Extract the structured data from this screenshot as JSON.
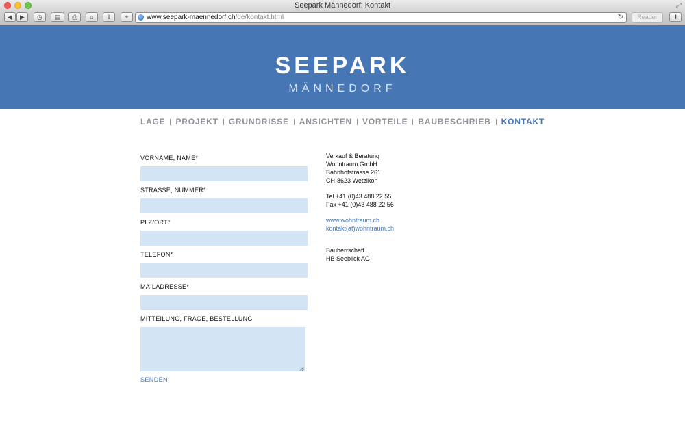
{
  "window": {
    "title": "Seepark Männedorf: Kontakt"
  },
  "toolbar": {
    "back_icon": "◀",
    "forward_icon": "▶",
    "history_icon": "◷",
    "bookmarks_icon": "▤",
    "print_icon": "⎙",
    "home_icon": "⌂",
    "share_icon": "⇪",
    "add_icon": "+",
    "url_domain": "www.seepark-maennedorf.ch",
    "url_path": "/de/kontakt.html",
    "reload_icon": "↻",
    "reader_label": "Reader",
    "downloads_icon": "⬇"
  },
  "header": {
    "logo_main": "SEEPARK",
    "logo_sub": "MÄNNEDORF",
    "bg_color": "#4676b3"
  },
  "nav": {
    "items": [
      {
        "label": "LAGE",
        "active": false
      },
      {
        "label": "PROJEKT",
        "active": false
      },
      {
        "label": "GRUNDRISSE",
        "active": false
      },
      {
        "label": "ANSICHTEN",
        "active": false
      },
      {
        "label": "VORTEILE",
        "active": false
      },
      {
        "label": "BAUBESCHRIEB",
        "active": false
      },
      {
        "label": "KONTAKT",
        "active": true
      }
    ]
  },
  "form": {
    "fields": [
      {
        "label": "VORNAME, NAME*",
        "value": ""
      },
      {
        "label": "STRASSE, NUMMER*",
        "value": ""
      },
      {
        "label": "PLZ/ORT*",
        "value": ""
      },
      {
        "label": "TELEFON*",
        "value": ""
      },
      {
        "label": "MAILADRESSE*",
        "value": ""
      }
    ],
    "message_label": "MITTEILUNG, FRAGE, BESTELLUNG",
    "message_value": "",
    "submit_label": "SENDEN"
  },
  "contact": {
    "line1": "Verkauf & Beratung",
    "company": "Wohntraum GmbH",
    "street": "Bahnhofstrasse 261",
    "city": "CH-8623 Wetzikon",
    "tel": "Tel +41 (0)43 488 22 55",
    "fax": "Fax +41 (0)43 488 22 56",
    "web": "www.wohntraum.ch",
    "email": "kontakt(at)wohntraum.ch",
    "owner_label": "Bauherrschaft",
    "owner": "HB Seeblick AG"
  }
}
